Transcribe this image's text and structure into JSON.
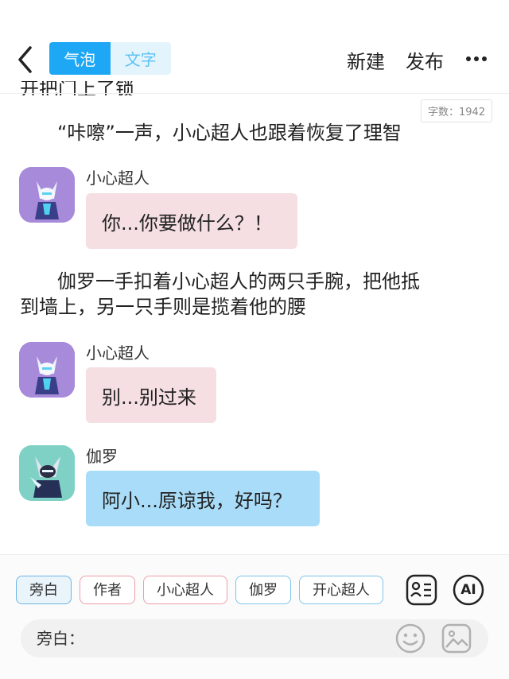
{
  "header": {
    "tabs": [
      {
        "label": "气泡"
      },
      {
        "label": "文字"
      }
    ],
    "new_label": "新建",
    "publish_label": "发布"
  },
  "partial_line": "开把门上了锁",
  "word_count": "字数：1942",
  "content": {
    "narration_1": "“咔嚓”一声，小心超人也跟着恢复了理智",
    "msg_1": {
      "name": "小心超人",
      "text": "你...你要做什么？！"
    },
    "narration_2a": "伽罗一手扣着小心超人的两只手腕，把他抵",
    "narration_2b": "到墙上，另一只手则是揽着他的腰",
    "msg_2": {
      "name": "小心超人",
      "text": "别...别过来"
    },
    "msg_3": {
      "name": "伽罗",
      "text": "阿小...原谅我，好吗？"
    }
  },
  "roles": [
    "旁白",
    "作者",
    "小心超人",
    "伽罗",
    "开心超人"
  ],
  "tools": {
    "ai_label": "AI"
  },
  "input": {
    "label": "旁白：",
    "value": ""
  },
  "colors": {
    "accent": "#1ea7f4",
    "pink_bubble": "#f5dfe2",
    "blue_bubble": "#a9dcf8"
  }
}
